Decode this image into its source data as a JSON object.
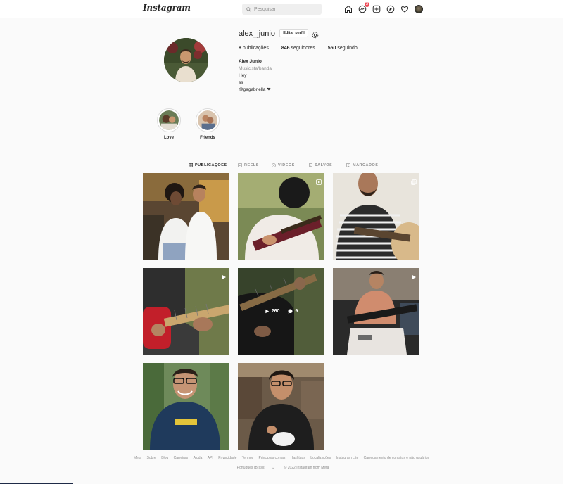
{
  "nav": {
    "logo": "Instagram",
    "search_placeholder": "Pesquisar",
    "messages_badge": "2"
  },
  "profile": {
    "username": "alex_jjunio",
    "edit_label": "Editar perfil",
    "stats": [
      {
        "count": "8",
        "label": "publicações"
      },
      {
        "count": "846",
        "label": "seguidores"
      },
      {
        "count": "550",
        "label": "seguindo"
      }
    ],
    "bio": {
      "name": "Alex Junio",
      "category": "Musicista/banda",
      "lines": [
        "Hey",
        "ss",
        "@gagabriella ❤"
      ]
    }
  },
  "highlights": [
    {
      "label": "Love"
    },
    {
      "label": "Friends"
    }
  ],
  "tabs": [
    {
      "label": "PUBLICAÇÕES",
      "icon": "grid-icon",
      "active": true
    },
    {
      "label": "REELS",
      "icon": "reels-icon",
      "active": false
    },
    {
      "label": "VÍDEOS",
      "icon": "video-icon",
      "active": false
    },
    {
      "label": "SALVOS",
      "icon": "bookmark-icon",
      "active": false
    },
    {
      "label": "MARCADOS",
      "icon": "tagged-icon",
      "active": false
    }
  ],
  "posts": [
    {
      "type": "photo",
      "icon": ""
    },
    {
      "type": "reel",
      "icon": "reel-icon"
    },
    {
      "type": "carousel",
      "icon": "carousel-icon"
    },
    {
      "type": "video",
      "icon": "video-play-icon"
    },
    {
      "type": "video",
      "icon": "",
      "overlay": {
        "views": "260",
        "comments": "9"
      }
    },
    {
      "type": "video",
      "icon": "video-play-icon"
    },
    {
      "type": "photo",
      "icon": ""
    },
    {
      "type": "photo",
      "icon": ""
    }
  ],
  "footer": {
    "links": [
      "Meta",
      "Sobre",
      "Blog",
      "Carreiras",
      "Ajuda",
      "API",
      "Privacidade",
      "Termos",
      "Principais contas",
      "Hashtags",
      "Localizações",
      "Instagram Lite",
      "Carregamento de contatos e não usuários"
    ],
    "language": "Português (Brasil)",
    "copyright": "© 2022 Instagram from Meta"
  },
  "colors": {
    "background": "#fafafa",
    "border": "#dbdbdb",
    "text": "#262626",
    "muted": "#8e8e8e",
    "badge": "#ed4956"
  }
}
